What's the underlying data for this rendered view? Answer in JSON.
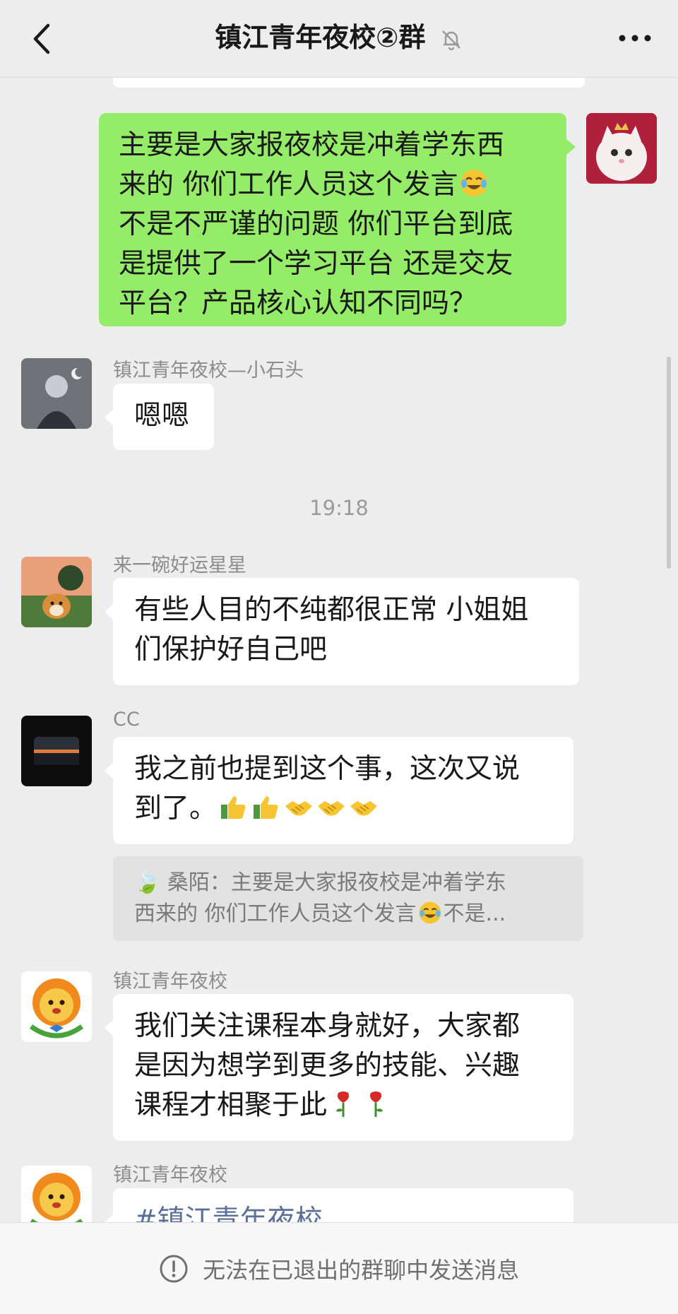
{
  "header": {
    "title": "镇江青年夜校②群",
    "back_icon": "chevron-left-icon",
    "mute_icon": "bell-off-icon",
    "more_icon": "more-horizontal-icon"
  },
  "messages": {
    "m1": {
      "text": "主要是大家报夜校是冲着学东西来的 你们工作人员这个发言😂不是不严谨的问题 你们平台到底是提供了一个学习平台 还是交友平台？产品核心认知不同吗？",
      "line1": "主要是大家报夜校是冲着学东西",
      "line2": "来的 你们工作人员这个发言",
      "line3": "不是不严谨的问题 你们平台到底",
      "line4": "是提供了一个学习平台 还是交友",
      "line5": "平台？产品核心认知不同吗？"
    },
    "m2": {
      "sender": "镇江青年夜校—小石头",
      "text": "嗯嗯"
    },
    "time1": "19:18",
    "m3": {
      "sender": "来一碗好运星星",
      "line1": "有些人目的不纯都很正常 小姐姐",
      "line2": "们保护好自己吧"
    },
    "m4": {
      "sender": "CC",
      "line1": "我之前也提到这个事，这次又说",
      "line2": "到了。",
      "quote_line1": "🍃 桑陌：主要是大家报夜校是冲着学东",
      "quote_line2a": "西来的 你们工作人员这个发言",
      "quote_line2b": "不是..."
    },
    "m5": {
      "sender": "镇江青年夜校",
      "line1": "我们关注课程本身就好，大家都",
      "line2": "是因为想学到更多的技能、兴趣",
      "line3": "课程才相聚于此"
    },
    "m6": {
      "sender": "镇江青年夜校",
      "line1": "#镇江青年夜校"
    }
  },
  "footer": {
    "notice": "无法在已退出的群聊中发送消息",
    "info_icon": "info-circle-icon"
  },
  "colors": {
    "sent_bubble": "#95ec69",
    "received_bubble": "#ffffff",
    "background": "#ededed"
  }
}
